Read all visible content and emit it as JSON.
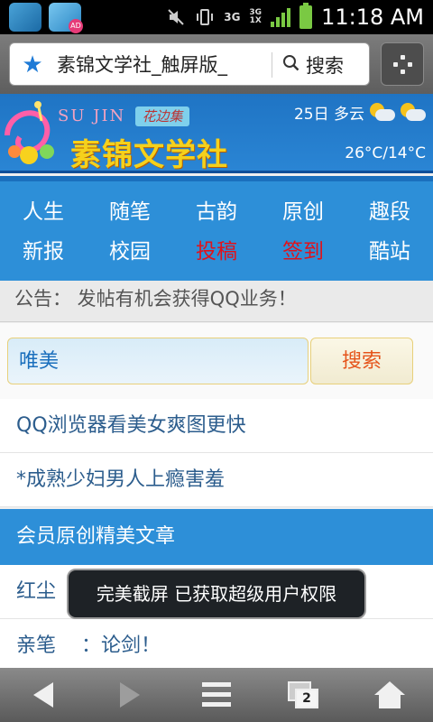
{
  "status_bar": {
    "time": "11:18 AM",
    "network": "3G",
    "network2": "3G",
    "network2_sub": "1X",
    "ad_badge": "AD",
    "icons": [
      "gallery-app-icon",
      "wifi-ad-app-icon",
      "mute-icon",
      "vibrate-icon",
      "signal-icon",
      "battery-icon"
    ]
  },
  "browser": {
    "url_text": "素锦文学社_触屏版_",
    "search_label": "搜索",
    "icons": [
      "bookmark-star-icon",
      "search-icon",
      "menu-grid-icon"
    ]
  },
  "site_header": {
    "logo_en": "SU JIN",
    "logo_tag": "花边集",
    "logo_cn": "素锦文学社",
    "weather_date_text": "25日 多云",
    "weather_temp": "26°C/14°C",
    "weather_icon": "partly-cloudy-icon"
  },
  "nav": {
    "row1": [
      "人生",
      "随笔",
      "古韵",
      "原创",
      "趣段"
    ],
    "row2": [
      "新报",
      "校园",
      "投稿",
      "签到",
      "酷站"
    ],
    "highlight_color": "#e0121b",
    "highlighted": [
      "投稿",
      "签到"
    ]
  },
  "notice": {
    "text": "公告： 发帖有机会获得QQ业务！"
  },
  "search": {
    "keyword": "唯美",
    "button": "搜索"
  },
  "links": [
    "QQ浏览器看美女爽图更快",
    "*成熟少妇男人上瘾害羞"
  ],
  "section": {
    "title": "会员原创精美文章",
    "articles": [
      "红尘",
      "亲笔    ：论剑！"
    ]
  },
  "toast": {
    "text": "完美截屏 已获取超级用户权限"
  },
  "bottom_bar": {
    "tab_count": "2",
    "icons": [
      "back-icon",
      "forward-icon",
      "menu-icon",
      "tabs-icon",
      "home-icon"
    ]
  },
  "colors": {
    "header_blue": "#2d8fd8",
    "link_color": "#2c5d8d",
    "search_button_text": "#e5541b",
    "logo_yellow": "#f5d11c"
  }
}
